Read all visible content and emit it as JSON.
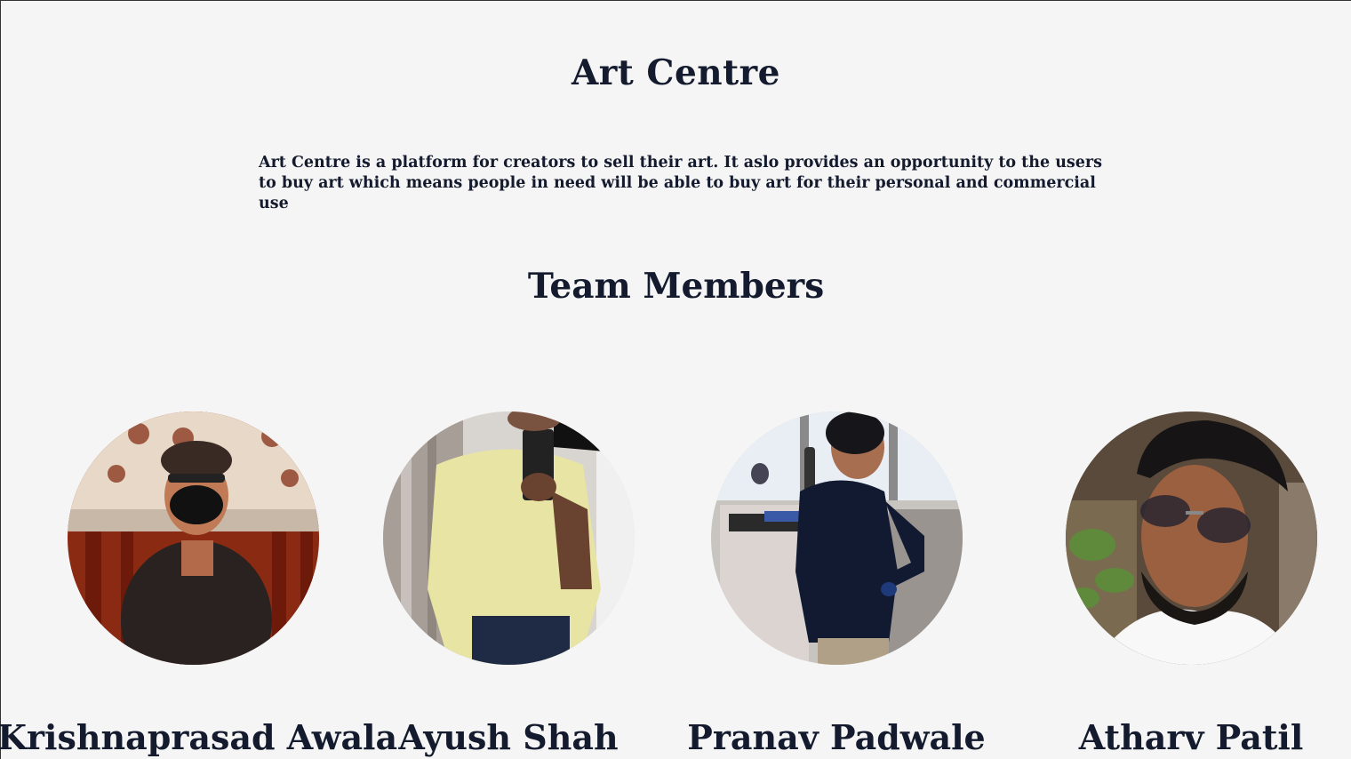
{
  "header": {
    "title": "Art Centre"
  },
  "about": {
    "text": "Art Centre is a platform for creators to sell their art. It aslo provides an opportunity to the users to buy art which means people in need will be able to buy art for their personal and commercial use"
  },
  "team": {
    "title": "Team Members",
    "members": [
      {
        "name": "Krishnaprasad Awala",
        "photo": "person-photo"
      },
      {
        "name": "Ayush Shah",
        "photo": "person-photo"
      },
      {
        "name": "Pranav Padwale",
        "photo": "person-photo"
      },
      {
        "name": "Atharv Patil",
        "photo": "person-photo"
      }
    ]
  },
  "colors": {
    "background": "#f5f5f5",
    "text": "#141b2e"
  }
}
